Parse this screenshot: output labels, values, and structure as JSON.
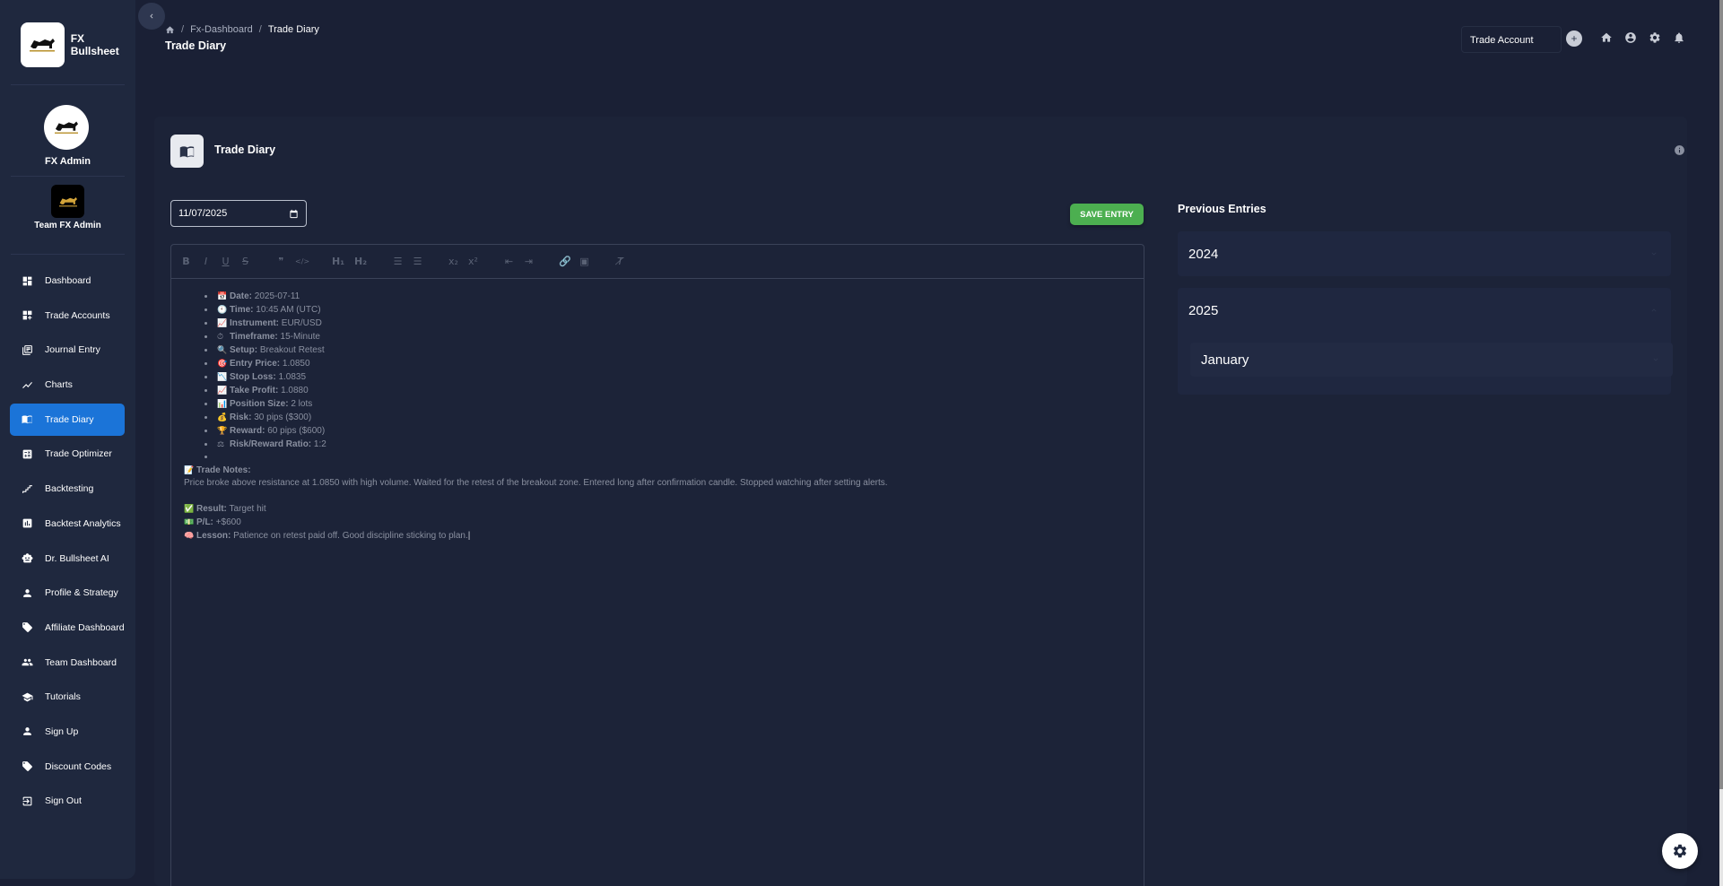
{
  "brand": {
    "name": "FX Bullsheet",
    "logo_text": "FX BULLSHEET"
  },
  "user": {
    "name": "FX Admin",
    "team": "Team FX Admin"
  },
  "nav": [
    {
      "label": "Dashboard",
      "icon": "dashboard-icon",
      "active": false
    },
    {
      "label": "Trade Accounts",
      "icon": "widgets-icon",
      "active": false
    },
    {
      "label": "Journal Entry",
      "icon": "library-icon",
      "active": false
    },
    {
      "label": "Charts",
      "icon": "chart-line-icon",
      "active": false
    },
    {
      "label": "Trade Diary",
      "icon": "book-icon",
      "active": true
    },
    {
      "label": "Trade Optimizer",
      "icon": "calculator-icon",
      "active": false
    },
    {
      "label": "Backtesting",
      "icon": "stairs-chart-icon",
      "active": false
    },
    {
      "label": "Backtest Analytics",
      "icon": "analytics-icon",
      "active": false
    },
    {
      "label": "Dr. Bullsheet AI",
      "icon": "robot-icon",
      "active": false
    },
    {
      "label": "Profile & Strategy",
      "icon": "person-icon",
      "active": false
    },
    {
      "label": "Affiliate Dashboard",
      "icon": "tag-icon",
      "active": false
    },
    {
      "label": "Team Dashboard",
      "icon": "group-icon",
      "active": false
    },
    {
      "label": "Tutorials",
      "icon": "school-icon",
      "active": false
    },
    {
      "label": "Sign Up",
      "icon": "person-add-icon",
      "active": false
    },
    {
      "label": "Discount Codes",
      "icon": "tag-icon",
      "active": false
    },
    {
      "label": "Sign Out",
      "icon": "logout-icon",
      "active": false
    }
  ],
  "breadcrumb": {
    "level1": "Fx-Dashboard",
    "level2": "Trade Diary"
  },
  "page_title": "Trade Diary",
  "topbar": {
    "account_label": "Trade Account"
  },
  "card": {
    "title": "Trade Diary"
  },
  "form": {
    "date": "11/07/2025",
    "save_label": "SAVE ENTRY"
  },
  "entry": {
    "fields": [
      {
        "emoji": "📅",
        "label": "Date:",
        "value": "2025-07-11"
      },
      {
        "emoji": "🕙",
        "label": "Time:",
        "value": "10:45 AM (UTC)"
      },
      {
        "emoji": "📈",
        "label": "Instrument:",
        "value": "EUR/USD"
      },
      {
        "emoji": "⏱",
        "label": "Timeframe:",
        "value": "15-Minute"
      },
      {
        "emoji": "🔍",
        "label": "Setup:",
        "value": "Breakout Retest"
      },
      {
        "emoji": "🎯",
        "label": "Entry Price:",
        "value": "1.0850"
      },
      {
        "emoji": "📉",
        "label": "Stop Loss:",
        "value": "1.0835"
      },
      {
        "emoji": "📈",
        "label": "Take Profit:",
        "value": "1.0880"
      },
      {
        "emoji": "📊",
        "label": "Position Size:",
        "value": "2 lots"
      },
      {
        "emoji": "💰",
        "label": "Risk:",
        "value": "30 pips ($300)"
      },
      {
        "emoji": "🏆",
        "label": "Reward:",
        "value": "60 pips ($600)"
      },
      {
        "emoji": "⚖",
        "label": "Risk/Reward Ratio:",
        "value": "1:2"
      }
    ],
    "notes_emoji": "📝",
    "notes_label": "Trade Notes:",
    "notes_text": "Price broke above resistance at 1.0850 with high volume. Waited for the retest of the breakout zone. Entered long after confirmation candle. Stopped watching after setting alerts.",
    "result": {
      "emoji": "✅",
      "label": "Result:",
      "value": "Target hit"
    },
    "pl": {
      "emoji": "💵",
      "label": "P/L:",
      "value": "+$600"
    },
    "lesson": {
      "emoji": "🧠",
      "label": "Lesson:",
      "value": "Patience on retest paid off. Good discipline sticking to plan."
    }
  },
  "previous": {
    "title": "Previous Entries",
    "years": [
      "2024",
      "2025"
    ],
    "month": "January"
  },
  "colors": {
    "accent": "#1b74d8",
    "save": "#4caf50",
    "background": "#1a2035",
    "sidebar": "#1f283e"
  }
}
